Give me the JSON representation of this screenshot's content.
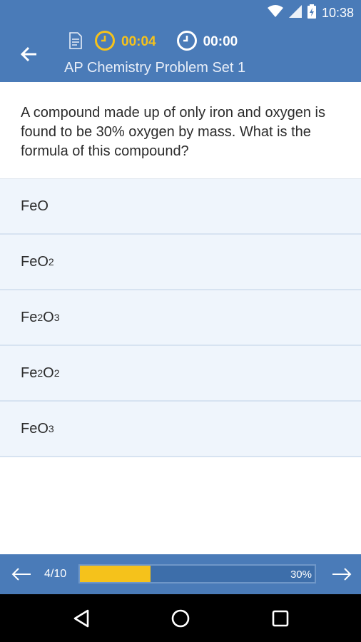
{
  "status_bar": {
    "time": "10:38",
    "icons": [
      "wifi-icon",
      "signal-icon",
      "battery-charging-icon"
    ]
  },
  "header": {
    "title": "AP Chemistry Problem Set 1",
    "elapsed_timer": "00:04",
    "total_timer": "00:00",
    "icons": [
      "back-arrow-icon",
      "document-icon",
      "clock-icon"
    ]
  },
  "question": {
    "text": "A compound made up of only iron and oxygen is found to be 30% oxygen by mass. What is the formula of this compound?"
  },
  "answers": [
    {
      "formula": [
        {
          "t": "FeO",
          "s": false
        }
      ]
    },
    {
      "formula": [
        {
          "t": "FeO",
          "s": false
        },
        {
          "t": "2",
          "s": true
        }
      ]
    },
    {
      "formula": [
        {
          "t": "Fe",
          "s": false
        },
        {
          "t": "2",
          "s": true
        },
        {
          "t": "O",
          "s": false
        },
        {
          "t": "3",
          "s": true
        }
      ]
    },
    {
      "formula": [
        {
          "t": "Fe",
          "s": false
        },
        {
          "t": "2",
          "s": true
        },
        {
          "t": "O",
          "s": false
        },
        {
          "t": "2",
          "s": true
        }
      ]
    },
    {
      "formula": [
        {
          "t": "FeO",
          "s": false
        },
        {
          "t": "3",
          "s": true
        }
      ]
    }
  ],
  "progress": {
    "page": "4/10",
    "percent_label": "30%",
    "fraction": 0.3
  },
  "colors": {
    "primary": "#4a7bb8",
    "accent": "#f5c21b",
    "answer_bg": "#eff5fc"
  },
  "system_nav": [
    "back-triangle-icon",
    "home-circle-icon",
    "recents-square-icon"
  ]
}
